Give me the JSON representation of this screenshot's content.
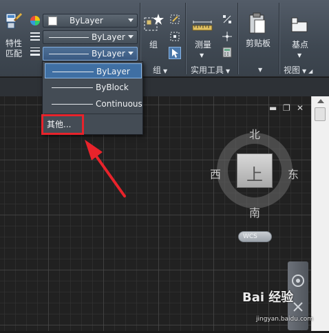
{
  "ribbon": {
    "match_properties": {
      "label_line1": "特性",
      "label_line2": "匹配"
    },
    "color_combo": {
      "value": "ByLayer"
    },
    "linetype_combo": {
      "value": "ByLayer"
    },
    "lineweight_combo": {
      "value": "ByLayer"
    },
    "group": {
      "label": "组",
      "panel_title": "组"
    },
    "utilities": {
      "measure_label": "测量",
      "panel_title": "实用工具"
    },
    "clipboard": {
      "label": "剪贴板"
    },
    "view": {
      "basepoint_label": "基点",
      "panel_title": "视图"
    }
  },
  "dropdown": {
    "items": [
      {
        "label": "ByLayer",
        "selected": true
      },
      {
        "label": "ByBlock",
        "selected": false
      },
      {
        "label": "Continuous",
        "selected": false
      }
    ],
    "other_label": "其他..."
  },
  "viewcube": {
    "north": "北",
    "south": "南",
    "east": "东",
    "west": "西",
    "top_face": "上",
    "coord_system": "WCS"
  },
  "window_controls": {
    "minimize": "▬",
    "restore": "❐",
    "close": "✕"
  },
  "watermark": {
    "brand": "Bai  经验",
    "url": "jingyan.baidu.com"
  },
  "colors": {
    "accent_selected": "#3f6fa3",
    "highlight_red": "#e8232b",
    "ribbon_bg": "#474f58",
    "canvas_bg": "#212121"
  }
}
